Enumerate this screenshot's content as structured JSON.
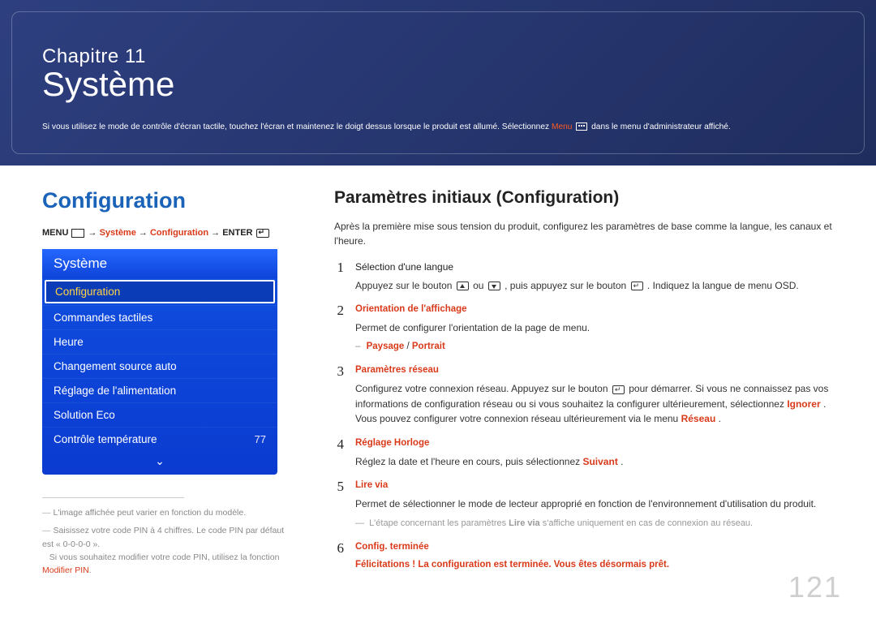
{
  "hero": {
    "chapter": "Chapitre 11",
    "title": "Système",
    "note_prefix": "Si vous utilisez le mode de contrôle d'écran tactile, touchez l'écran et maintenez le doigt dessus lorsque le produit est allumé. Sélectionnez ",
    "note_menu": "Menu",
    "note_suffix": " dans le menu d'administrateur affiché."
  },
  "left": {
    "section_title": "Configuration",
    "breadcrumb": {
      "menu": "MENU",
      "arrow": " → ",
      "p1": "Système",
      "p2": "Configuration",
      "enter": "ENTER"
    },
    "osd": {
      "header": "Système",
      "items": [
        {
          "label": "Configuration",
          "selected": true
        },
        {
          "label": "Commandes tactiles"
        },
        {
          "label": "Heure"
        },
        {
          "label": "Changement source auto"
        },
        {
          "label": "Réglage de l'alimentation"
        },
        {
          "label": "Solution Eco"
        },
        {
          "label": "Contrôle température",
          "value": "77"
        }
      ],
      "more_glyph": "⌄"
    },
    "footnotes": {
      "f1": "L'image affichée peut varier en fonction du modèle.",
      "f2a": "Saisissez votre code PIN à 4 chiffres. Le code PIN par défaut est « 0-0-0-0 ».",
      "f2b": "Si vous souhaitez modifier votre code PIN, utilisez la fonction ",
      "f2b_hl": "Modifier PIN",
      "f2b_end": "."
    }
  },
  "right": {
    "subheading": "Paramètres initiaux (Configuration)",
    "lead": "Après la première mise sous tension du produit, configurez les paramètres de base comme la langue, les canaux et l'heure.",
    "steps": {
      "s1": {
        "num": "1",
        "title": "Sélection d'une langue",
        "body_a": "Appuyez sur le bouton ",
        "body_b": " ou ",
        "body_c": ", puis appuyez sur le bouton ",
        "body_d": ". Indiquez la langue de menu OSD."
      },
      "s2": {
        "num": "2",
        "title": "Orientation de l'affichage",
        "body": "Permet de configurer l'orientation de la page de menu.",
        "opt_a": "Paysage",
        "opt_sep": " / ",
        "opt_b": "Portrait"
      },
      "s3": {
        "num": "3",
        "title": "Paramètres réseau",
        "body_a": "Configurez votre connexion réseau. Appuyez sur le bouton ",
        "body_b": " pour démarrer. Si vous ne connaissez pas vos informations de configuration réseau ou si vous souhaitez la configurer ultérieurement, sélectionnez ",
        "hl_ignorer": "Ignorer",
        "body_c": ". Vous pouvez configurer votre connexion réseau ultérieurement via le menu ",
        "hl_reseau": "Réseau",
        "body_d": "."
      },
      "s4": {
        "num": "4",
        "title": "Réglage Horloge",
        "body_a": "Réglez la date et l'heure en cours, puis sélectionnez ",
        "hl_suivant": "Suivant",
        "body_b": "."
      },
      "s5": {
        "num": "5",
        "title": "Lire via",
        "body": "Permet de sélectionner le mode de lecteur approprié en fonction de l'environnement d'utilisation du produit.",
        "note_a": "L'étape concernant les paramètres ",
        "note_hl": "Lire via",
        "note_b": " s'affiche uniquement en cas de connexion au réseau."
      },
      "s6": {
        "num": "6",
        "title": "Config. terminée",
        "body": "Félicitations ! La configuration est terminée. Vous êtes désormais prêt."
      }
    }
  },
  "page_number": "121"
}
